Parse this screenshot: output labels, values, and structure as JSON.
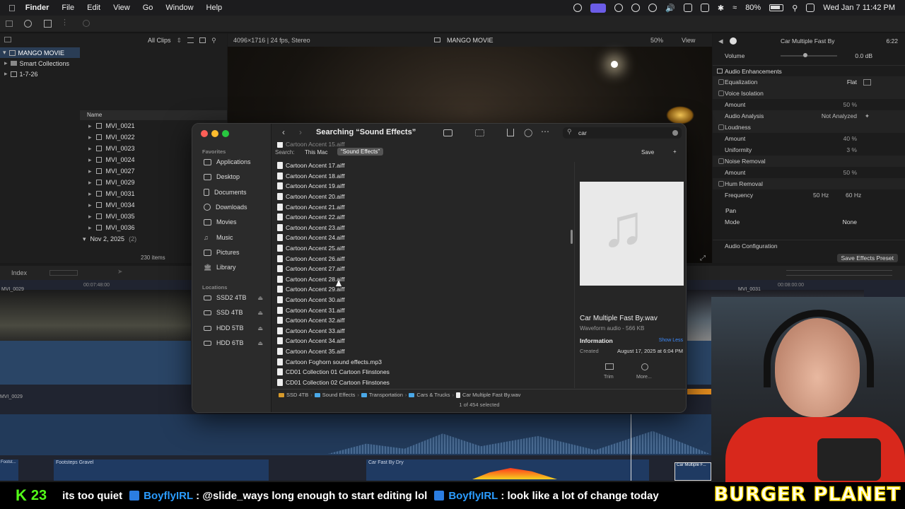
{
  "menubar": {
    "app": "Finder",
    "items": [
      "File",
      "Edit",
      "View",
      "Go",
      "Window",
      "Help"
    ],
    "battery": "80%",
    "datetime": "Wed Jan 7  11:42 PM"
  },
  "fcp": {
    "library_name": "MANGO MOVIE",
    "smart_collections": "Smart Collections",
    "event": "1-7-26",
    "filter": "All Clips",
    "format": "4096×1716 | 24 fps, Stereo",
    "project_title": "MANGO MOVIE",
    "zoom": "50%",
    "view_label": "View",
    "name_header": "Name",
    "clips": [
      "MVI_0021",
      "MVI_0022",
      "MVI_0023",
      "MVI_0024",
      "MVI_0027",
      "MVI_0029",
      "MVI_0031",
      "MVI_0034",
      "MVI_0035",
      "MVI_0036"
    ],
    "date_group": "Nov 2, 2025",
    "date_group_count": "(2)",
    "item_count": "230 items",
    "index_label": "Index",
    "timecode_1": "00:07:48:00",
    "timecode_2": "00:08:00:00",
    "clip_label_top_left": "MVI_0029",
    "clip_label_top_right": "MVI_0031",
    "clip_label_mid": "MVI_0029",
    "audio_clip_1": "Footsteps Gravel",
    "audio_clip_2": "Car Fast By Dry",
    "audio_clip_3": "Car Multiple F...",
    "audio_clip_4": "Footst..."
  },
  "inspector": {
    "title": "Car Multiple Fast By",
    "duration": "6:22",
    "volume_label": "Volume",
    "volume_value": "0.0  dB",
    "enhancements": "Audio Enhancements",
    "equalization": "Equalization",
    "eq_value": "Flat",
    "voice_isolation": "Voice Isolation",
    "amount": "Amount",
    "vi_amount": "50  %",
    "audio_analysis": "Audio Analysis",
    "analysis_value": "Not Analyzed",
    "loudness": "Loudness",
    "loud_amount": "40  %",
    "uniformity": "Uniformity",
    "uniformity_value": "3  %",
    "noise_removal": "Noise Removal",
    "nr_amount": "50  %",
    "hum_removal": "Hum Removal",
    "frequency": "Frequency",
    "freq_50": "50 Hz",
    "freq_60": "60 Hz",
    "pan": "Pan",
    "mode": "Mode",
    "mode_value": "None",
    "audio_config": "Audio Configuration",
    "save_preset": "Save Effects Preset"
  },
  "finder": {
    "title": "Searching “Sound Effects”",
    "search_value": "car",
    "search_label": "Search:",
    "scope_this_mac": "This Mac",
    "scope_selected": "“Sound Effects”",
    "save_button": "Save",
    "add_button": "+",
    "favorites_header": "Favorites",
    "favorites": [
      {
        "label": "Applications",
        "icon": "applications-icon"
      },
      {
        "label": "Desktop",
        "icon": "desktop-icon"
      },
      {
        "label": "Documents",
        "icon": "document-icon"
      },
      {
        "label": "Downloads",
        "icon": "downloads-icon"
      },
      {
        "label": "Movies",
        "icon": "movies-icon"
      },
      {
        "label": "Music",
        "icon": "music-icon"
      },
      {
        "label": "Pictures",
        "icon": "pictures-icon"
      },
      {
        "label": "Library",
        "icon": "library-icon"
      }
    ],
    "locations_header": "Locations",
    "locations": [
      "SSD2 4TB",
      "SSD 4TB",
      "HDD 5TB",
      "HDD 6TB"
    ],
    "files": [
      "Cartoon Accent 15.aiff",
      "Cartoon Accent 17.aiff",
      "Cartoon Accent 18.aiff",
      "Cartoon Accent 19.aiff",
      "Cartoon Accent 20.aiff",
      "Cartoon Accent 21.aiff",
      "Cartoon Accent 22.aiff",
      "Cartoon Accent 23.aiff",
      "Cartoon Accent 24.aiff",
      "Cartoon Accent 25.aiff",
      "Cartoon Accent 26.aiff",
      "Cartoon Accent 27.aiff",
      "Cartoon Accent 28.aiff",
      "Cartoon Accent 29.aiff",
      "Cartoon Accent 30.aiff",
      "Cartoon Accent 31.aiff",
      "Cartoon Accent 32.aiff",
      "Cartoon Accent 33.aiff",
      "Cartoon Accent 34.aiff",
      "Cartoon Accent 35.aiff",
      "Cartoon Foghorn sound effects.mp3",
      "CD01 Collection 01 Cartoon Flinstones",
      "CD01 Collection 02 Cartoon Flinstones"
    ],
    "preview_name": "Car Multiple Fast By.wav",
    "preview_kind": "Waveform audio - 566 KB",
    "info_label": "Information",
    "show_less": "Show Less",
    "created_label": "Created",
    "created_value": "August 17, 2025 at 6:04 PM",
    "trim_label": "Trim",
    "more_label": "More...",
    "path": [
      "SSD 4TB",
      "Sound Effects",
      "Transportation",
      "Cars & Trucks",
      "Car Multiple Fast By.wav"
    ],
    "status": "1 of 454 selected"
  },
  "ticker": {
    "viewers": "23",
    "msg1": "its too quiet",
    "user1": "BoyflyIRL",
    "msg2": ": @slide_ways long enough to start editing lol",
    "user2": "BoyflyIRL",
    "msg3": ": look like a lot of change today",
    "brand": "BURGER  PLANET"
  }
}
